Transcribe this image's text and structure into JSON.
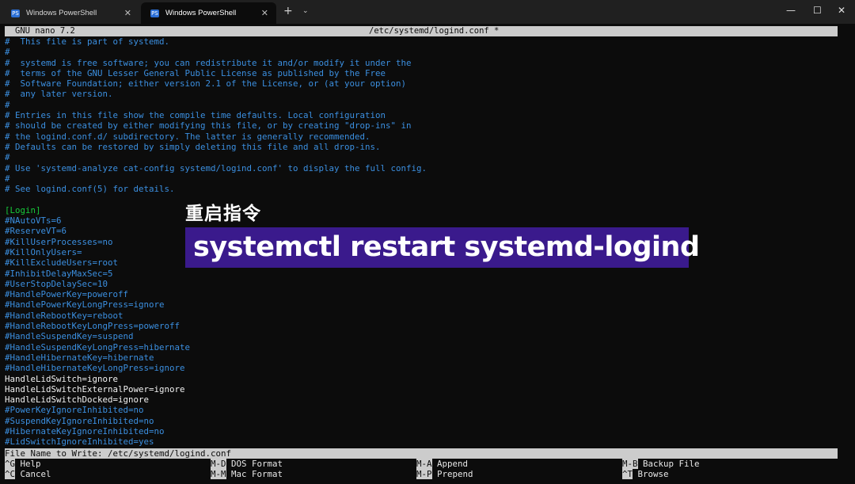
{
  "tabs": [
    {
      "label": "Windows PowerShell",
      "close": "✕"
    },
    {
      "label": "Windows PowerShell",
      "close": "✕"
    }
  ],
  "tab_icon": "PS",
  "tabbar": {
    "new_tab": "+",
    "dropdown": "⌄"
  },
  "window_controls": {
    "minimize": "—",
    "maximize": "☐",
    "close": "✕"
  },
  "nano": {
    "version": "GNU nano 7.2",
    "filename": "/etc/systemd/logind.conf *"
  },
  "file_lines": [
    "#  This file is part of systemd.",
    "#",
    "#  systemd is free software; you can redistribute it and/or modify it under the",
    "#  terms of the GNU Lesser General Public License as published by the Free",
    "#  Software Foundation; either version 2.1 of the License, or (at your option)",
    "#  any later version.",
    "#",
    "# Entries in this file show the compile time defaults. Local configuration",
    "# should be created by either modifying this file, or by creating \"drop-ins\" in",
    "# the logind.conf.d/ subdirectory. The latter is generally recommended.",
    "# Defaults can be restored by simply deleting this file and all drop-ins.",
    "#",
    "# Use 'systemd-analyze cat-config systemd/logind.conf' to display the full config.",
    "#",
    "# See logind.conf(5) for details.",
    "",
    "[Login]",
    "#NAutoVTs=6",
    "#ReserveVT=6",
    "#KillUserProcesses=no",
    "#KillOnlyUsers=",
    "#KillExcludeUsers=root",
    "#InhibitDelayMaxSec=5",
    "#UserStopDelaySec=10",
    "#HandlePowerKey=poweroff",
    "#HandlePowerKeyLongPress=ignore",
    "#HandleRebootKey=reboot",
    "#HandleRebootKeyLongPress=poweroff",
    "#HandleSuspendKey=suspend",
    "#HandleSuspendKeyLongPress=hibernate",
    "#HandleHibernateKey=hibernate",
    "#HandleHibernateKeyLongPress=ignore",
    "HandleLidSwitch=ignore",
    "HandleLidSwitchExternalPower=ignore",
    "HandleLidSwitchDocked=ignore",
    "#PowerKeyIgnoreInhibited=no",
    "#SuspendKeyIgnoreInhibited=no",
    "#HibernateKeyIgnoreInhibited=no",
    "#LidSwitchIgnoreInhibited=yes"
  ],
  "overlay": {
    "caption": "重启指令",
    "command": "systemctl restart systemd-logind"
  },
  "prompt": {
    "text": "File Name to Write: /etc/systemd/logind.conf"
  },
  "shortcuts": [
    {
      "key": "^G",
      "label": " Help"
    },
    {
      "key": "M-D",
      "label": " DOS Format"
    },
    {
      "key": "M-A",
      "label": " Append"
    },
    {
      "key": "M-B",
      "label": " Backup File"
    },
    {
      "key": "^C",
      "label": " Cancel"
    },
    {
      "key": "M-M",
      "label": " Mac Format"
    },
    {
      "key": "M-P",
      "label": " Prepend"
    },
    {
      "key": "^T",
      "label": " Browse"
    }
  ],
  "colors": {
    "comment": "#3b8fe0",
    "section": "#17c93a",
    "active_setting": "#f2f2f2",
    "overlay_bg": "#3a1a8c",
    "bar_bg": "#cccccc"
  }
}
